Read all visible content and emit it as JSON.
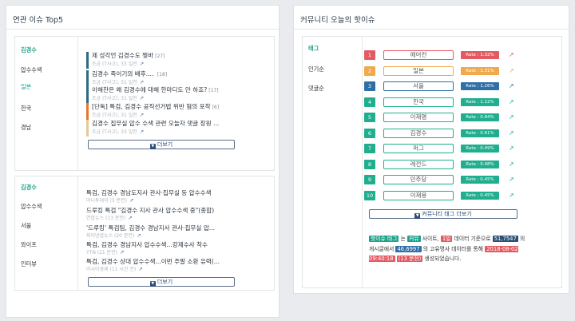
{
  "left_panel": {
    "title": "연관 이슈 Top5",
    "card1": {
      "tabs": [
        "김경수",
        "압수수색",
        "일본",
        "한국",
        "경남"
      ],
      "active_tab": 0,
      "items": [
        {
          "title": "제 성각언 김경수도 찢바",
          "count": "[27]",
          "meta": "조금 (T사고), 33 일전",
          "color": "#2e6b80"
        },
        {
          "title": "김경수 죽이기의 배후.... ",
          "count": "[18]",
          "meta": "조금 (T사고), 31 일전",
          "color": "#2e6b80"
        },
        {
          "title": "이해찬은 왜 김경수에 대해 한마디도 안 하죠?",
          "count": "[17]",
          "meta": "조금 (T사고), 31 일전",
          "color": "#2e6b80"
        },
        {
          "title": "[단독] 특검, 김경수 공직선거법 위반 혐의 포착",
          "count": "[6]",
          "meta": "조금 (T사고), 31 일전",
          "color": "#e8752a"
        },
        {
          "title": "김경수 집무실 압수 수색 관련 오늘자 댓글 장원 ...",
          "count": "",
          "meta": "조금 (T사고), 33 일전",
          "color": "#e6c99a"
        }
      ],
      "more_label": "더보기"
    },
    "card2": {
      "tabs": [
        "김경수",
        "압수수색",
        "서울",
        "와이프",
        "인터뷰"
      ],
      "active_tab": 0,
      "items": [
        {
          "title": "특검, 김경수 경남도지사 관사·집무실 등 압수수색",
          "meta": "머니투데이 (3 분전)"
        },
        {
          "title": "드루킹 특검 \"김경수 지사 관사 압수수색 중\"(종합)",
          "meta": "연합뉴스 (13 분전)"
        },
        {
          "title": "'드루킹' 특검팀, 김경수 경남지사 관사·집무실 압...",
          "meta": "파이낸셜뉴스 (20 분전)"
        },
        {
          "title": "특검, 김경수 경남지사 압수수색...강제수사 착수",
          "meta": "YTN (21 분전)"
        },
        {
          "title": "특검, 김경수 상대 압수수색...이번 주말 소환 유력(...",
          "meta": "아시아경제 (11 시간 전)"
        }
      ],
      "more_label": "더보기"
    }
  },
  "right_panel": {
    "title": "커뮤니티 오늘의 핫이슈",
    "tabs": [
      "태그",
      "인기순",
      "댓글순"
    ],
    "active_tab": 0,
    "rows": [
      {
        "num": "1",
        "tag": "에어컨",
        "rate": "Rate : 1.32%",
        "color": "#e35a62"
      },
      {
        "num": "2",
        "tag": "일본",
        "rate": "Rate : 1.31%",
        "color": "#f0a94b"
      },
      {
        "num": "3",
        "tag": "서울",
        "rate": "Rate : 1.26%",
        "color": "#2f6fa5"
      },
      {
        "num": "4",
        "tag": "한국",
        "rate": "Rate : 1.12%",
        "color": "#1fae8e"
      },
      {
        "num": "5",
        "tag": "이재명",
        "rate": "Rate : 0.84%",
        "color": "#1fae8e"
      },
      {
        "num": "6",
        "tag": "김경수",
        "rate": "Rate : 0.61%",
        "color": "#1fae8e"
      },
      {
        "num": "7",
        "tag": "퍼그",
        "rate": "Rate : 0.49%",
        "color": "#1fae8e"
      },
      {
        "num": "8",
        "tag": "레전드",
        "rate": "Rate : 0.48%",
        "color": "#1fae8e"
      },
      {
        "num": "9",
        "tag": "민주당",
        "rate": "Rate : 0.45%",
        "color": "#1fae8e"
      },
      {
        "num": "10",
        "tag": "이재용",
        "rate": "Rate : 0.45%",
        "color": "#1fae8e"
      }
    ],
    "more_label": "커뮤니티 태그 더보기",
    "note": {
      "p1": "핫이슈 태그",
      "p2": "는",
      "p3": "커뮤",
      "p4": "사이트,",
      "p5": "1일",
      "p6": "데이터 기준으로",
      "p7": "51,7547",
      "p8": "의 게시글에서",
      "p9": "46,6997",
      "p10": "의 고유명사 데이터를",
      "p11": "통해",
      "p12": "2018-08-02 09:40:18",
      "p13": "(13 분전)",
      "p14": "생성되었습니다."
    }
  },
  "colors": {
    "accent": "#1fa28a",
    "navy": "#2d4e78",
    "rate_red": "#e35a62"
  }
}
